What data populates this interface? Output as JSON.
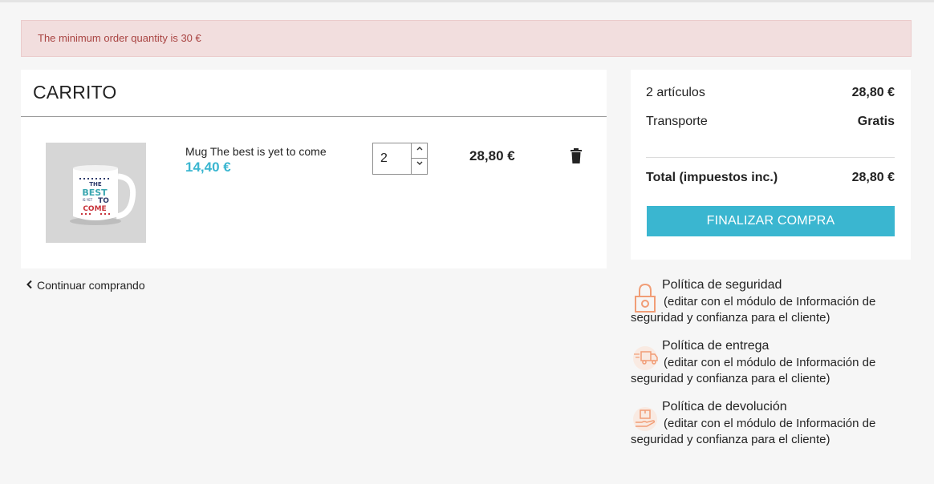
{
  "alert": {
    "text": "The minimum order quantity is 30 €"
  },
  "cart": {
    "title": "CARRITO",
    "item": {
      "name": "Mug The best is yet to come",
      "unit_price": "14,40 €",
      "quantity": "2",
      "line_total": "28,80 €",
      "image_text": [
        "THE",
        "BEST",
        "IS YET",
        "TO",
        "COME"
      ]
    },
    "continue_label": "Continuar comprando"
  },
  "summary": {
    "items_label": "2 artículos",
    "items_value": "28,80 €",
    "shipping_label": "Transporte",
    "shipping_value": "Gratis",
    "total_label": "Total (impuestos inc.)",
    "total_value": "28,80 €",
    "checkout_label": "FINALIZAR COMPRA"
  },
  "reassurance": [
    {
      "title": "Política de seguridad",
      "desc": "(editar con el módulo de Información de seguridad y confianza para el cliente)",
      "icon": "lock-icon"
    },
    {
      "title": "Política de entrega",
      "desc": "(editar con el módulo de Información de seguridad y confianza para el cliente)",
      "icon": "truck-icon"
    },
    {
      "title": "Política de devolución",
      "desc": "(editar con el módulo de Información de seguridad y confianza para el cliente)",
      "icon": "return-box-icon"
    }
  ],
  "colors": {
    "accent": "#3ab6d0",
    "alert_bg": "#f2dede",
    "alert_text": "#a94442",
    "icon_orange": "#f19d76"
  }
}
